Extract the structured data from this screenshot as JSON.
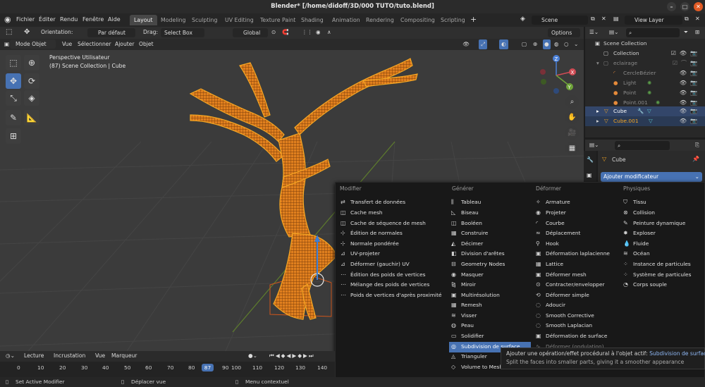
{
  "window": {
    "title": "Blender* [/home/didoff/3D/000 TUTO/tuto.blend]"
  },
  "menubar": {
    "items": [
      "Fichier",
      "Éditer",
      "Rendu",
      "Fenêtre",
      "Aide"
    ]
  },
  "workspaces": {
    "tabs": [
      "Layout",
      "Modeling",
      "Sculpting",
      "UV Editing",
      "Texture Paint",
      "Shading",
      "Animation",
      "Rendering",
      "Compositing",
      "Scripting"
    ],
    "active": "Layout"
  },
  "scene": {
    "name": "Scene"
  },
  "view_layer": {
    "name": "View Layer"
  },
  "viewport_header": {
    "orientation_label": "Orientation:",
    "orientation_value": "Par défaut",
    "drag_label": "Drag:",
    "drag_value": "Select Box",
    "transform_orientation": "Global",
    "options": "Options"
  },
  "viewport_header2": {
    "mode": "Mode Objet",
    "menus": [
      "Vue",
      "Sélectionner",
      "Ajouter",
      "Objet"
    ]
  },
  "viewport": {
    "info_line1": "Perspective Utilisateur",
    "info_line2": "(87) Scene Collection | Cube"
  },
  "gizmo": {
    "x": "X",
    "y": "Y",
    "z": "Z"
  },
  "outliner": {
    "rows": [
      {
        "label": "Scene Collection"
      },
      {
        "label": "Collection"
      },
      {
        "label": "eclairage"
      },
      {
        "label": "CercleBézier"
      },
      {
        "label": "Light"
      },
      {
        "label": "Point"
      },
      {
        "label": "Point.001"
      },
      {
        "label": "Cube"
      },
      {
        "label": "Cube.001"
      }
    ]
  },
  "properties": {
    "object_name": "Cube",
    "add_modifier": "Ajouter modificateur"
  },
  "add_modifier_menu": {
    "columns": [
      {
        "header": "Modifier",
        "items": [
          "Transfert de données",
          "Cache mesh",
          "Cache de séquence de mesh",
          "Édition de normales",
          "Normale pondérée",
          "UV-projeter",
          "Déformer (gauchir) UV",
          "Édition des poids de vertices",
          "Mélange des poids de vertices",
          "Poids de vertices d'après proximité"
        ]
      },
      {
        "header": "Générer",
        "items": [
          "Tableau",
          "Biseau",
          "Booléen",
          "Construire",
          "Décimer",
          "Division d'arêtes",
          "Geometry Nodes",
          "Masquer",
          "Miroir",
          "Multirésolution",
          "Remesh",
          "Visser",
          "Peau",
          "Solidifier",
          "Subdivision de surface",
          "Trianguler",
          "Volume to Mesh"
        ]
      },
      {
        "header": "Déformer",
        "items": [
          "Armature",
          "Projeter",
          "Courbe",
          "Déplacement",
          "Hook",
          "Déformation laplacienne",
          "Lattice",
          "Déformer mesh",
          "Contracter/envelopper",
          "Déformer simple",
          "Adoucir",
          "Smooth Corrective",
          "Smooth Laplacian",
          "Déformation de surface",
          "Déformer (ondulation)"
        ]
      },
      {
        "header": "Physiques",
        "items": [
          "Tissu",
          "Collision",
          "Peinture dynamique",
          "Exploser",
          "Fluide",
          "Océan",
          "Instance de particules",
          "Système de particules",
          "Corps souple"
        ]
      }
    ],
    "highlighted": "Subdivision de surface"
  },
  "tooltip": {
    "line1": "Ajouter une opération/effet procédural à l'objet actif:",
    "line1_value": "Subdivision de surface",
    "line2": "Split the faces into smaller parts, giving it a smoother appearance"
  },
  "timeline": {
    "menus": [
      "Lecture",
      "Incrustation",
      "Vue",
      "Marqueur"
    ],
    "current_frame": "87",
    "ticks": [
      "0",
      "10",
      "20",
      "30",
      "40",
      "50",
      "60",
      "70",
      "80",
      "90",
      "100",
      "110",
      "120",
      "130",
      "140"
    ]
  },
  "statusbar": {
    "items": [
      "Set Active Modifier",
      "Déplacer vue",
      "Menu contextuel"
    ]
  },
  "colors": {
    "accent": "#4772b3",
    "selection_orange": "#f5a623",
    "background": "#3b3b3b"
  }
}
